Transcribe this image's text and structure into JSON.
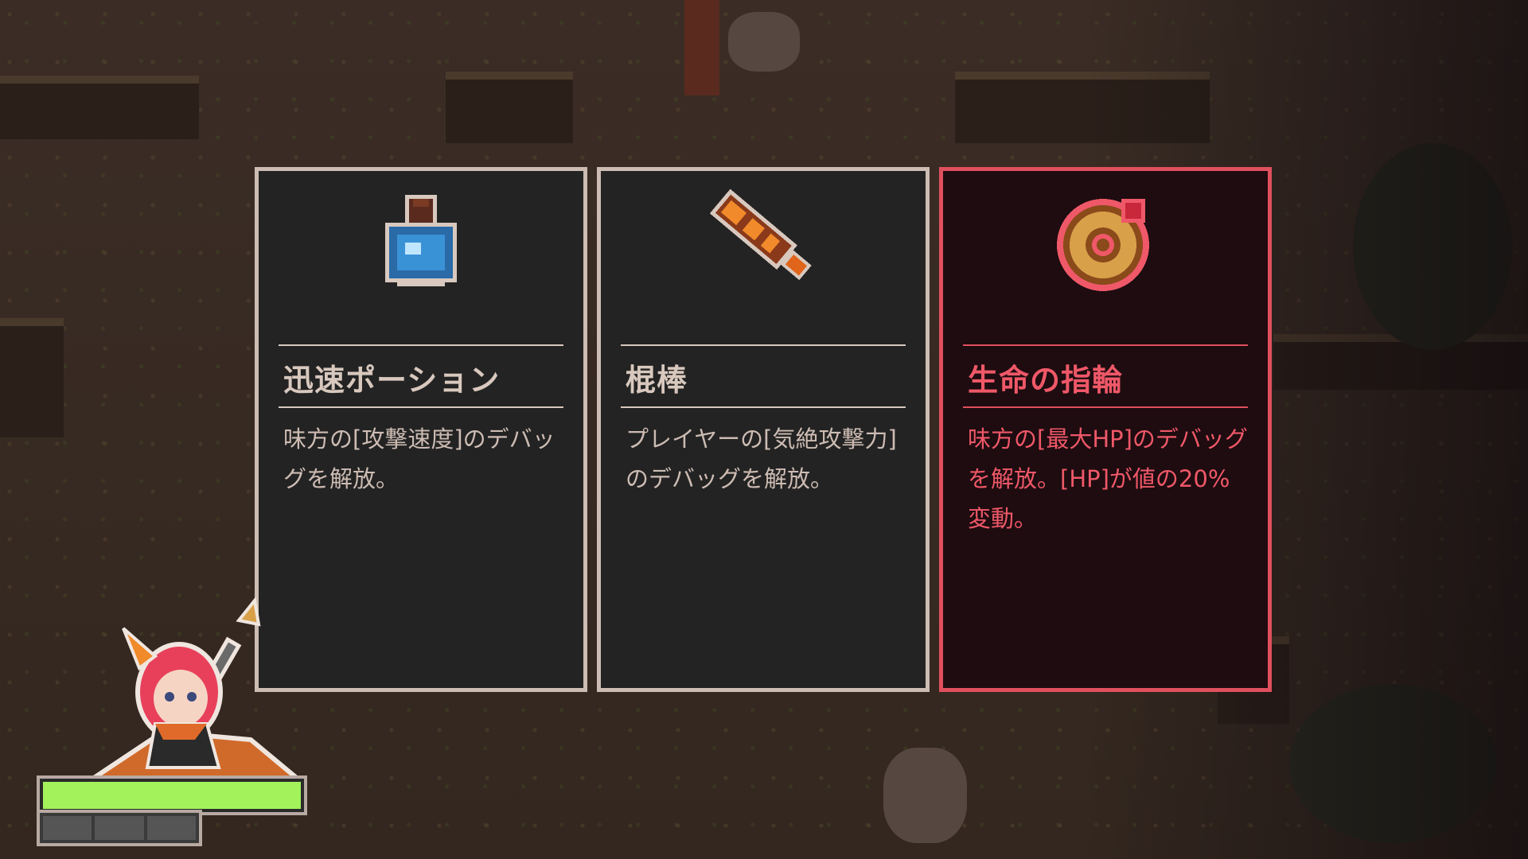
{
  "cards": [
    {
      "title": "迅速ポーション",
      "description": "味方の[攻撃速度]のデバッグを解放。",
      "icon": "potion-icon",
      "selected": false
    },
    {
      "title": "棍棒",
      "description": "プレイヤーの[気絶攻撃力]のデバッグを解放。",
      "icon": "club-icon",
      "selected": false
    },
    {
      "title": "生命の指輪",
      "description": "味方の[最大HP]のデバッグを解放。[HP]が値の20%変動。",
      "icon": "ring-icon",
      "selected": true
    }
  ],
  "player": {
    "avatar": "heroine-portrait",
    "hp_fraction": 1.0,
    "sub_segments": 3
  },
  "colors": {
    "card_bg": "#232323",
    "card_border": "#cdbcb3",
    "selected_border": "#e0505e",
    "selected_text": "#ef5868",
    "hp_fill": "#a3f25c"
  }
}
